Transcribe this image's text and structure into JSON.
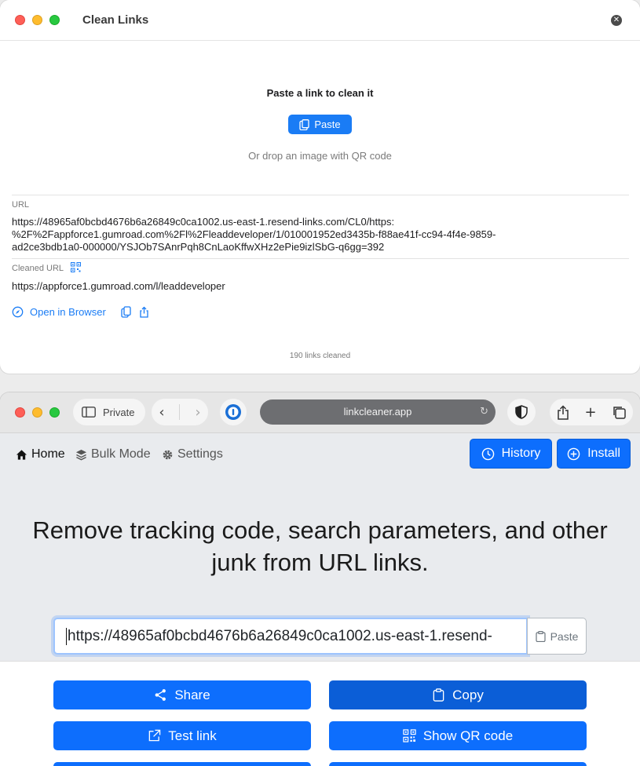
{
  "clean_links_app": {
    "title": "Clean Links",
    "paste_prompt": "Paste a link to clean it",
    "paste_button": "Paste",
    "drop_hint": "Or drop an image with QR code",
    "url_label": "URL",
    "url_value": "https://48965af0bcbd4676b6a26849c0ca1002.us-east-1.resend-links.com/CL0/https:%2F%2Fappforce1.gumroad.com%2Fl%2Fleaddeveloper/1/010001952ed3435b-f88ae41f-cc94-4f4e-9859-ad2ce3bdb1a0-000000/YSJOb7SAnrPqh8CnLaoKffwXHz2ePie9izlSbG-q6gg=392",
    "url_lines": [
      "https://48965af0bcbd4676b6a26849c0ca1002.us-east-1.resend-links.com/CL0/https:",
      "%2F%2Fappforce1.gumroad.com%2Fl%2Fleaddeveloper/1/010001952ed3435b-f88ae41f-cc94-4f4e-9859-",
      "ad2ce3bdb1a0-000000/YSJOb7SAnrPqh8CnLaoKffwXHz2ePie9izlSbG-q6gg=392"
    ],
    "cleaned_label": "Cleaned URL",
    "cleaned_value": "https://appforce1.gumroad.com/l/leaddeveloper",
    "open_in_browser": "Open in Browser",
    "links_cleaned": "190 links cleaned"
  },
  "browser": {
    "private_label": "Private",
    "address": "linkcleaner.app"
  },
  "site": {
    "nav": {
      "home": "Home",
      "bulk_mode": "Bulk Mode",
      "settings": "Settings"
    },
    "history_button": "History",
    "install_button": "Install",
    "headline": "Remove tracking code, search parameters, and other junk from URL links.",
    "input_value": "https://48965af0bcbd4676b6a26849c0ca1002.us-east-1.resend-",
    "paste_button": "Paste",
    "actions": {
      "share": "Share",
      "copy": "Copy",
      "test_link": "Test link",
      "show_qr": "Show QR code"
    }
  },
  "colors": {
    "accent": "#0d6efd",
    "accent_dark": "#0b5ed7",
    "macos_blue": "#1a7cf5"
  }
}
